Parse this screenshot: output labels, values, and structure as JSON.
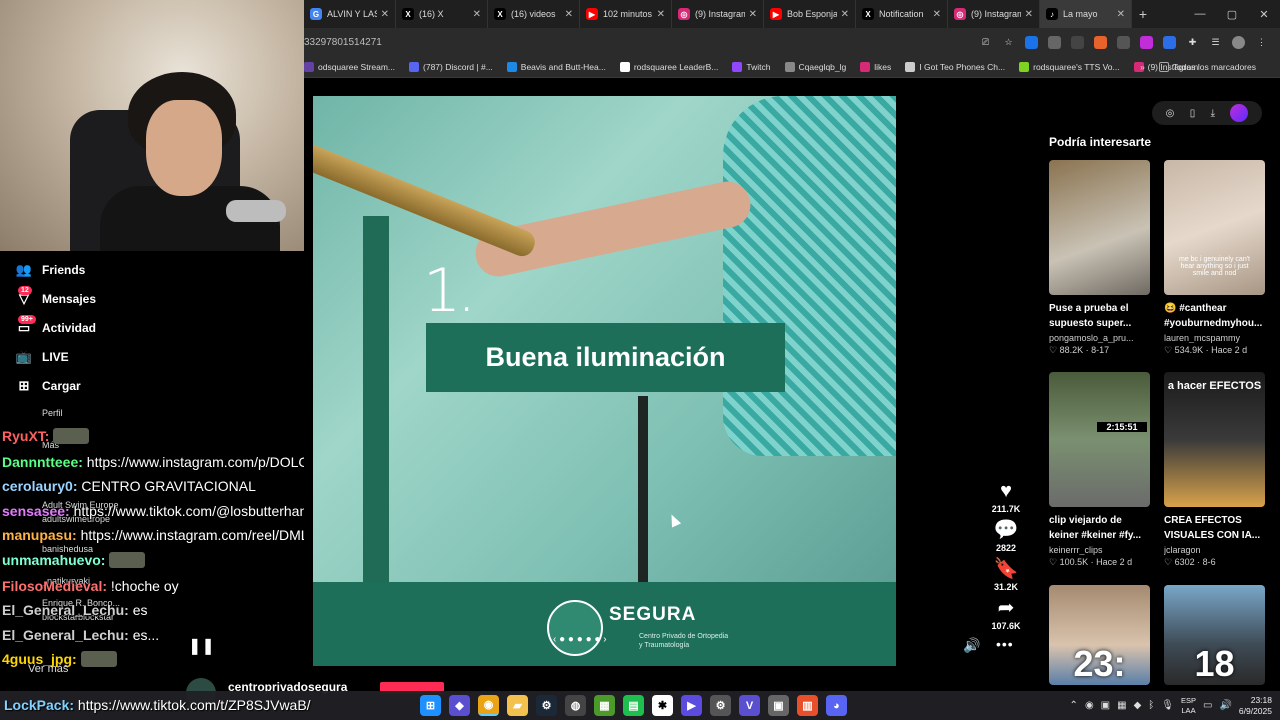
{
  "browser": {
    "tabs": [
      {
        "label": "ALVIN Y LAS",
        "fav_color": "#4285f4",
        "fav_glyph": "G"
      },
      {
        "label": "(16) X",
        "fav_color": "#000000",
        "fav_glyph": "X"
      },
      {
        "label": "(16) videos",
        "fav_color": "#000000",
        "fav_glyph": "X"
      },
      {
        "label": "102 minutos",
        "fav_color": "#ff0000",
        "fav_glyph": "▶"
      },
      {
        "label": "(9) Instagram",
        "fav_color": "#d62976",
        "fav_glyph": "◎"
      },
      {
        "label": "Bob Esponja",
        "fav_color": "#ff0000",
        "fav_glyph": "▶"
      },
      {
        "label": "Notification",
        "fav_color": "#000000",
        "fav_glyph": "X"
      },
      {
        "label": "(9) Instagram",
        "fav_color": "#d62976",
        "fav_glyph": "◎"
      },
      {
        "label": "La mayo",
        "fav_color": "#010101",
        "fav_glyph": "♪",
        "active": true
      }
    ],
    "new_tab": "+",
    "address_text": "33297801514271",
    "bookmarks": [
      {
        "label": "odsquaree Stream...",
        "color": "#6441a5"
      },
      {
        "label": "(787) Discord | #...",
        "color": "#5865f2"
      },
      {
        "label": "Beavis and Butt-Hea...",
        "color": "#1e88e5"
      },
      {
        "label": "rodsquaree LeaderB...",
        "color": "#ffffff"
      },
      {
        "label": "Twitch",
        "color": "#9146ff"
      },
      {
        "label": "Cqaeglqb_lg",
        "color": "#888888"
      },
      {
        "label": "likes",
        "color": "#d62976"
      },
      {
        "label": "I Got Teo Phones Ch...",
        "color": "#cccccc"
      },
      {
        "label": "rodsquaree's TTS Vo...",
        "color": "#7ed321"
      },
      {
        "label": "(9) Instagram",
        "color": "#d62976"
      }
    ],
    "bookmarks_more": "»",
    "all_bookmarks": "Todos los marcadores"
  },
  "nav": {
    "items": [
      {
        "label": "Friends",
        "icon": "friends-icon",
        "glyph": "👥"
      },
      {
        "label": "Mensajes",
        "icon": "message-icon",
        "glyph": "▽",
        "badge": "12"
      },
      {
        "label": "Actividad",
        "icon": "activity-icon",
        "glyph": "▭",
        "badge": "99+"
      },
      {
        "label": "LIVE",
        "icon": "live-icon",
        "glyph": "📺"
      },
      {
        "label": "Cargar",
        "icon": "upload-icon",
        "glyph": "⊞"
      }
    ]
  },
  "chat": {
    "lines": [
      {
        "user": "RyuXT:",
        "msg": "",
        "color": "#ff6060",
        "emote": true
      },
      {
        "user": "Dannntteee:",
        "msg": " https://www.instagram.com/p/DOLC",
        "color": "#5cff86"
      },
      {
        "user": "cerolaury0:",
        "msg": " CENTRO GRAVITACIONAL",
        "color": "#9ad4ff"
      },
      {
        "user": "sensasee:",
        "msg": " https://www.tiktok.com/@losbutterhanc",
        "color": "#e57cff"
      },
      {
        "user": "manupasu:",
        "msg": " https://www.instagram.com/reel/DML",
        "color": "#ffb347"
      },
      {
        "user": "unmamahuevo:",
        "msg": "",
        "color": "#7fffd4",
        "emote": true
      },
      {
        "user": "FilosoMedieval:",
        "msg": " !choche oy",
        "color": "#ff7070"
      },
      {
        "user": "El_General_Lechu:",
        "msg": " es",
        "color": "#cfcfcf"
      },
      {
        "user": "El_General_Lechu:",
        "msg": " es...",
        "color": "#cfcfcf"
      },
      {
        "user": "4guus_jpg:",
        "msg": "",
        "color": "#ffd700",
        "emote": true
      }
    ],
    "ghost_texts": [
      {
        "text": "Perfil"
      },
      {
        "text": "Más"
      },
      {
        "text": "Adult Swim Europe"
      },
      {
        "text": "adultswimeurope"
      },
      {
        "text": "banishedusa"
      },
      {
        "text": "_natikuryaki"
      },
      {
        "text": "Enrique R. Bonco..."
      },
      {
        "text": "blockstarblockstar"
      }
    ],
    "see_more": "Ver más",
    "pause": "❚❚",
    "lockpack_user": "LockPack:",
    "lockpack_msg": " https://www.tiktok.com/t/ZP8SJVwaB/"
  },
  "video": {
    "number": "1.",
    "banner_text": "Buena iluminación",
    "brand_name": "SEGURA",
    "brand_sub": "Centro Privado de Ortopedia y Traumatología",
    "carousel_dots": "‹ ● ● ● ● ● ›"
  },
  "actions": {
    "like": {
      "count": "211.7K",
      "glyph": "♥"
    },
    "comment": {
      "count": "2822",
      "glyph": "💬"
    },
    "save": {
      "count": "31.2K",
      "glyph": "🔖"
    },
    "share": {
      "count": "107.6K",
      "glyph": "➦"
    },
    "volume": "🔊",
    "more": "•••"
  },
  "creator": {
    "name": "centroprivadosegura"
  },
  "recs": {
    "title": "Podría interesarte",
    "items": [
      {
        "title": "Puse a prueba el supuesto super...",
        "author": "pongamoslo_a_pru...",
        "likes": "♡ 88.2K",
        "date": "8-17",
        "thumb_text": "",
        "bg": "linear-gradient(160deg,#8a7350,#c9c2b5 60%,#6f6a62)"
      },
      {
        "title": "😆 #canthear #youburnedmyhou...",
        "author": "lauren_mcspammy",
        "likes": "♡ 534.9K",
        "date": "Hace 2 d",
        "thumb_text": "me bc i genuinely can't hear anything so i just smile and nod",
        "bg": "linear-gradient(160deg,#c7b7a6,#e6d9cc 50%,#a89684)"
      },
      {
        "title": "clip viejardo de keiner #keiner #fy...",
        "author": "keinerrr_clips",
        "likes": "♡ 100.5K",
        "date": "Hace 2 d",
        "thumb_text": "2:15:51",
        "bg": "linear-gradient(180deg,#4a5b3a,#7a9070 50%,#6b6b6b)"
      },
      {
        "title": "CREA EFECTOS VISUALES CON IA...",
        "author": "jclaragon",
        "likes": "♡ 6302",
        "date": "8-6",
        "thumb_text": "a hacer EFECTOS",
        "bg": "linear-gradient(180deg,#1b1b1b,#3a3a3a 50%,#d8a24a)"
      },
      {
        "title": "",
        "author": "",
        "likes": "",
        "date": "",
        "thumb_text": "23:",
        "bg": "linear-gradient(180deg,#a58a70,#d9c3ad 60%,#5a7fa8)"
      },
      {
        "title": "",
        "author": "",
        "likes": "",
        "date": "",
        "thumb_text": "18",
        "bg": "linear-gradient(180deg,#7aa7c9,#3e4a55 60%,#2a2a2a)"
      }
    ]
  },
  "taskbar": {
    "apps": [
      {
        "name": "windows-start-icon",
        "glyph": "⊞",
        "color": "#1e90ff"
      },
      {
        "name": "app-icon-1",
        "glyph": "◆",
        "color": "#5a4fcf"
      },
      {
        "name": "chrome-icon",
        "glyph": "◉",
        "color": "#e8a317",
        "active": true
      },
      {
        "name": "folder-icon",
        "glyph": "▰",
        "color": "#f2c14e"
      },
      {
        "name": "steam-icon",
        "glyph": "⚙",
        "color": "#1b2838"
      },
      {
        "name": "app-icon-2",
        "glyph": "◍",
        "color": "#444444"
      },
      {
        "name": "minecraft-icon",
        "glyph": "▦",
        "color": "#4c9a2a"
      },
      {
        "name": "app-icon-3",
        "glyph": "▤",
        "color": "#1fbf4f"
      },
      {
        "name": "app-icon-4",
        "glyph": "✱",
        "color": "#ffffff"
      },
      {
        "name": "app-icon-5",
        "glyph": "▶",
        "color": "#5b4bdf"
      },
      {
        "name": "settings-icon",
        "glyph": "⚙",
        "color": "#555555"
      },
      {
        "name": "app-icon-6",
        "glyph": "V",
        "color": "#5a4fcf"
      },
      {
        "name": "app-icon-7",
        "glyph": "▣",
        "color": "#666666"
      },
      {
        "name": "app-icon-8",
        "glyph": "▥",
        "color": "#e8502c"
      },
      {
        "name": "discord-icon",
        "glyph": "◕",
        "color": "#5865f2"
      }
    ],
    "lang_top": "ESP",
    "lang_bottom": "LAA",
    "time": "23:18",
    "date": "6/9/2025"
  }
}
